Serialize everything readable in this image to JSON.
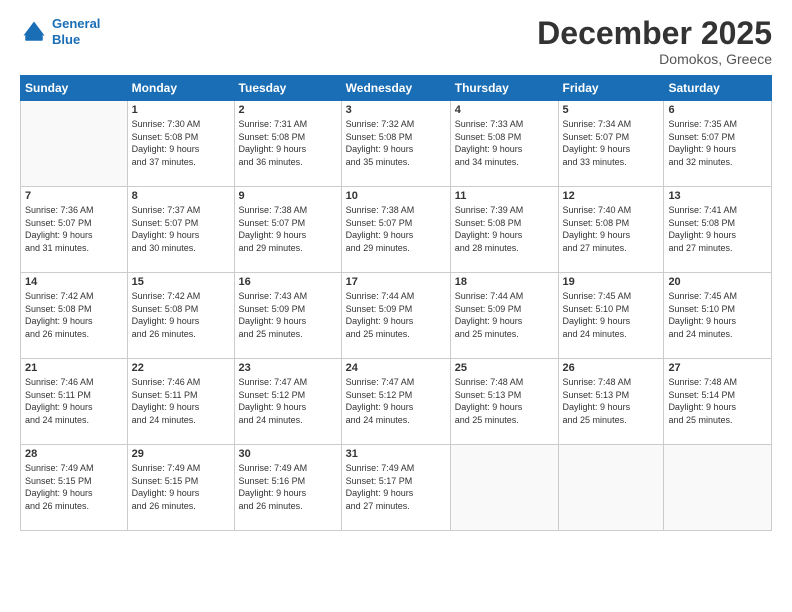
{
  "logo": {
    "line1": "General",
    "line2": "Blue"
  },
  "title": "December 2025",
  "subtitle": "Domokos, Greece",
  "days_header": [
    "Sunday",
    "Monday",
    "Tuesday",
    "Wednesday",
    "Thursday",
    "Friday",
    "Saturday"
  ],
  "weeks": [
    [
      {
        "day": "",
        "info": ""
      },
      {
        "day": "1",
        "info": "Sunrise: 7:30 AM\nSunset: 5:08 PM\nDaylight: 9 hours\nand 37 minutes."
      },
      {
        "day": "2",
        "info": "Sunrise: 7:31 AM\nSunset: 5:08 PM\nDaylight: 9 hours\nand 36 minutes."
      },
      {
        "day": "3",
        "info": "Sunrise: 7:32 AM\nSunset: 5:08 PM\nDaylight: 9 hours\nand 35 minutes."
      },
      {
        "day": "4",
        "info": "Sunrise: 7:33 AM\nSunset: 5:08 PM\nDaylight: 9 hours\nand 34 minutes."
      },
      {
        "day": "5",
        "info": "Sunrise: 7:34 AM\nSunset: 5:07 PM\nDaylight: 9 hours\nand 33 minutes."
      },
      {
        "day": "6",
        "info": "Sunrise: 7:35 AM\nSunset: 5:07 PM\nDaylight: 9 hours\nand 32 minutes."
      }
    ],
    [
      {
        "day": "7",
        "info": "Sunrise: 7:36 AM\nSunset: 5:07 PM\nDaylight: 9 hours\nand 31 minutes."
      },
      {
        "day": "8",
        "info": "Sunrise: 7:37 AM\nSunset: 5:07 PM\nDaylight: 9 hours\nand 30 minutes."
      },
      {
        "day": "9",
        "info": "Sunrise: 7:38 AM\nSunset: 5:07 PM\nDaylight: 9 hours\nand 29 minutes."
      },
      {
        "day": "10",
        "info": "Sunrise: 7:38 AM\nSunset: 5:07 PM\nDaylight: 9 hours\nand 29 minutes."
      },
      {
        "day": "11",
        "info": "Sunrise: 7:39 AM\nSunset: 5:08 PM\nDaylight: 9 hours\nand 28 minutes."
      },
      {
        "day": "12",
        "info": "Sunrise: 7:40 AM\nSunset: 5:08 PM\nDaylight: 9 hours\nand 27 minutes."
      },
      {
        "day": "13",
        "info": "Sunrise: 7:41 AM\nSunset: 5:08 PM\nDaylight: 9 hours\nand 27 minutes."
      }
    ],
    [
      {
        "day": "14",
        "info": "Sunrise: 7:42 AM\nSunset: 5:08 PM\nDaylight: 9 hours\nand 26 minutes."
      },
      {
        "day": "15",
        "info": "Sunrise: 7:42 AM\nSunset: 5:08 PM\nDaylight: 9 hours\nand 26 minutes."
      },
      {
        "day": "16",
        "info": "Sunrise: 7:43 AM\nSunset: 5:09 PM\nDaylight: 9 hours\nand 25 minutes."
      },
      {
        "day": "17",
        "info": "Sunrise: 7:44 AM\nSunset: 5:09 PM\nDaylight: 9 hours\nand 25 minutes."
      },
      {
        "day": "18",
        "info": "Sunrise: 7:44 AM\nSunset: 5:09 PM\nDaylight: 9 hours\nand 25 minutes."
      },
      {
        "day": "19",
        "info": "Sunrise: 7:45 AM\nSunset: 5:10 PM\nDaylight: 9 hours\nand 24 minutes."
      },
      {
        "day": "20",
        "info": "Sunrise: 7:45 AM\nSunset: 5:10 PM\nDaylight: 9 hours\nand 24 minutes."
      }
    ],
    [
      {
        "day": "21",
        "info": "Sunrise: 7:46 AM\nSunset: 5:11 PM\nDaylight: 9 hours\nand 24 minutes."
      },
      {
        "day": "22",
        "info": "Sunrise: 7:46 AM\nSunset: 5:11 PM\nDaylight: 9 hours\nand 24 minutes."
      },
      {
        "day": "23",
        "info": "Sunrise: 7:47 AM\nSunset: 5:12 PM\nDaylight: 9 hours\nand 24 minutes."
      },
      {
        "day": "24",
        "info": "Sunrise: 7:47 AM\nSunset: 5:12 PM\nDaylight: 9 hours\nand 24 minutes."
      },
      {
        "day": "25",
        "info": "Sunrise: 7:48 AM\nSunset: 5:13 PM\nDaylight: 9 hours\nand 25 minutes."
      },
      {
        "day": "26",
        "info": "Sunrise: 7:48 AM\nSunset: 5:13 PM\nDaylight: 9 hours\nand 25 minutes."
      },
      {
        "day": "27",
        "info": "Sunrise: 7:48 AM\nSunset: 5:14 PM\nDaylight: 9 hours\nand 25 minutes."
      }
    ],
    [
      {
        "day": "28",
        "info": "Sunrise: 7:49 AM\nSunset: 5:15 PM\nDaylight: 9 hours\nand 26 minutes."
      },
      {
        "day": "29",
        "info": "Sunrise: 7:49 AM\nSunset: 5:15 PM\nDaylight: 9 hours\nand 26 minutes."
      },
      {
        "day": "30",
        "info": "Sunrise: 7:49 AM\nSunset: 5:16 PM\nDaylight: 9 hours\nand 26 minutes."
      },
      {
        "day": "31",
        "info": "Sunrise: 7:49 AM\nSunset: 5:17 PM\nDaylight: 9 hours\nand 27 minutes."
      },
      {
        "day": "",
        "info": ""
      },
      {
        "day": "",
        "info": ""
      },
      {
        "day": "",
        "info": ""
      }
    ]
  ]
}
